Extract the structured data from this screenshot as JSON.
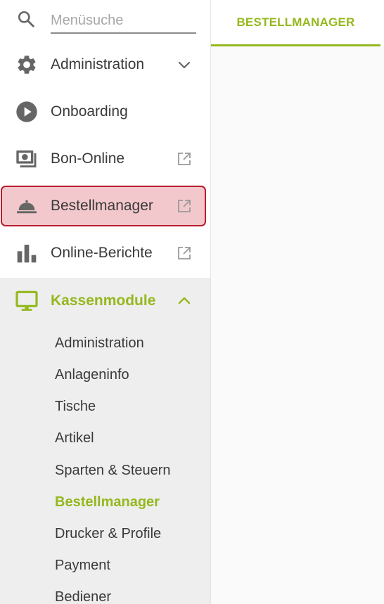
{
  "colors": {
    "accent": "#95b81e",
    "highlight_fill": "#f2c8cc",
    "highlight_border": "#b81d2b",
    "icon_gray": "#666666",
    "text": "#3a3a3a"
  },
  "search": {
    "placeholder": "Menüsuche",
    "icon": "search-icon"
  },
  "menu": {
    "items": [
      {
        "label": "Administration",
        "icon": "gear-icon",
        "trail": "chevron-down-icon"
      },
      {
        "label": "Onboarding",
        "icon": "play-circle-icon",
        "trail": ""
      },
      {
        "label": "Bon-Online",
        "icon": "receipt-money-icon",
        "trail": "external-link-icon"
      },
      {
        "label": "Bestellmanager",
        "icon": "cloche-icon",
        "trail": "external-link-icon",
        "highlighted": true
      },
      {
        "label": "Online-Berichte",
        "icon": "bar-chart-icon",
        "trail": "external-link-icon"
      },
      {
        "label": "Kassenmodule",
        "icon": "monitor-icon",
        "trail": "chevron-up-icon",
        "expanded": true
      }
    ]
  },
  "kassenmodule_sub": {
    "items": [
      {
        "label": "Administration"
      },
      {
        "label": "Anlageninfo"
      },
      {
        "label": "Tische"
      },
      {
        "label": "Artikel"
      },
      {
        "label": "Sparten & Steuern"
      },
      {
        "label": "Bestellmanager",
        "active": true
      },
      {
        "label": "Drucker & Profile"
      },
      {
        "label": "Payment"
      },
      {
        "label": "Bediener"
      }
    ]
  },
  "main": {
    "tab_label": "BESTELLMANAGER"
  }
}
